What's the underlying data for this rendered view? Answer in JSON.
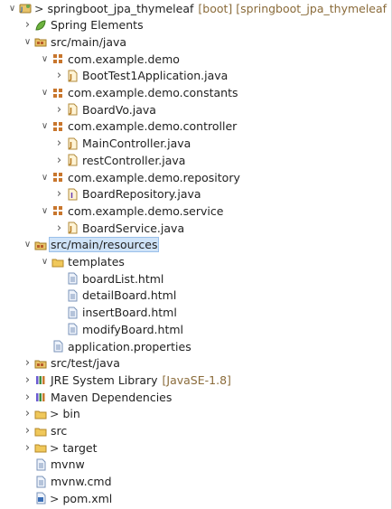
{
  "explorer": {
    "items": [
      {
        "depth": 0,
        "twist": "down",
        "icon": "project-icon",
        "arrow": ">",
        "label": "springboot_jpa_thymeleaf",
        "decor": " [boot] [springboot_jpa_thymeleaf master]"
      },
      {
        "depth": 1,
        "twist": "right",
        "icon": "spring-elements-icon",
        "label": "Spring Elements"
      },
      {
        "depth": 1,
        "twist": "down",
        "icon": "source-folder-icon",
        "label": "src/main/java"
      },
      {
        "depth": 2,
        "twist": "down",
        "icon": "package-icon",
        "label": "com.example.demo"
      },
      {
        "depth": 3,
        "twist": "right",
        "icon": "java-file-icon",
        "label": "BootTest1Application.java"
      },
      {
        "depth": 2,
        "twist": "down",
        "icon": "package-icon",
        "label": "com.example.demo.constants"
      },
      {
        "depth": 3,
        "twist": "right",
        "icon": "java-file-icon",
        "label": "BoardVo.java"
      },
      {
        "depth": 2,
        "twist": "down",
        "icon": "package-icon",
        "label": "com.example.demo.controller"
      },
      {
        "depth": 3,
        "twist": "right",
        "icon": "java-file-icon",
        "label": "MainController.java"
      },
      {
        "depth": 3,
        "twist": "right",
        "icon": "java-file-icon",
        "label": "restController.java"
      },
      {
        "depth": 2,
        "twist": "down",
        "icon": "package-icon",
        "label": "com.example.demo.repository"
      },
      {
        "depth": 3,
        "twist": "right",
        "icon": "java-interface-icon",
        "label": "BoardRepository.java"
      },
      {
        "depth": 2,
        "twist": "down",
        "icon": "package-icon",
        "label": "com.example.demo.service"
      },
      {
        "depth": 3,
        "twist": "right",
        "icon": "java-file-icon",
        "label": "BoardService.java"
      },
      {
        "depth": 1,
        "twist": "down",
        "icon": "source-folder-icon",
        "label": "src/main/resources",
        "selected": true
      },
      {
        "depth": 2,
        "twist": "down",
        "icon": "folder-icon",
        "label": "templates"
      },
      {
        "depth": 3,
        "twist": "none",
        "icon": "file-icon",
        "label": "boardList.html"
      },
      {
        "depth": 3,
        "twist": "none",
        "icon": "file-icon",
        "label": "detailBoard.html"
      },
      {
        "depth": 3,
        "twist": "none",
        "icon": "file-icon",
        "label": "insertBoard.html"
      },
      {
        "depth": 3,
        "twist": "none",
        "icon": "file-icon",
        "label": "modifyBoard.html"
      },
      {
        "depth": 2,
        "twist": "none",
        "icon": "file-icon",
        "label": "application.properties"
      },
      {
        "depth": 1,
        "twist": "right",
        "icon": "source-folder-icon",
        "label": "src/test/java"
      },
      {
        "depth": 1,
        "twist": "right",
        "icon": "library-icon",
        "label": "JRE System Library",
        "decor": " [JavaSE-1.8]"
      },
      {
        "depth": 1,
        "twist": "right",
        "icon": "library-icon",
        "label": "Maven Dependencies"
      },
      {
        "depth": 1,
        "twist": "right",
        "icon": "folder-icon",
        "arrow": ">",
        "label": "bin"
      },
      {
        "depth": 1,
        "twist": "right",
        "icon": "folder-icon",
        "label": "src"
      },
      {
        "depth": 1,
        "twist": "right",
        "icon": "folder-icon",
        "arrow": ">",
        "label": "target"
      },
      {
        "depth": 1,
        "twist": "none",
        "icon": "file-icon",
        "label": "mvnw"
      },
      {
        "depth": 1,
        "twist": "none",
        "icon": "file-icon",
        "label": "mvnw.cmd"
      },
      {
        "depth": 1,
        "twist": "none",
        "icon": "xml-file-icon",
        "arrow": ">",
        "label": "pom.xml"
      }
    ]
  }
}
